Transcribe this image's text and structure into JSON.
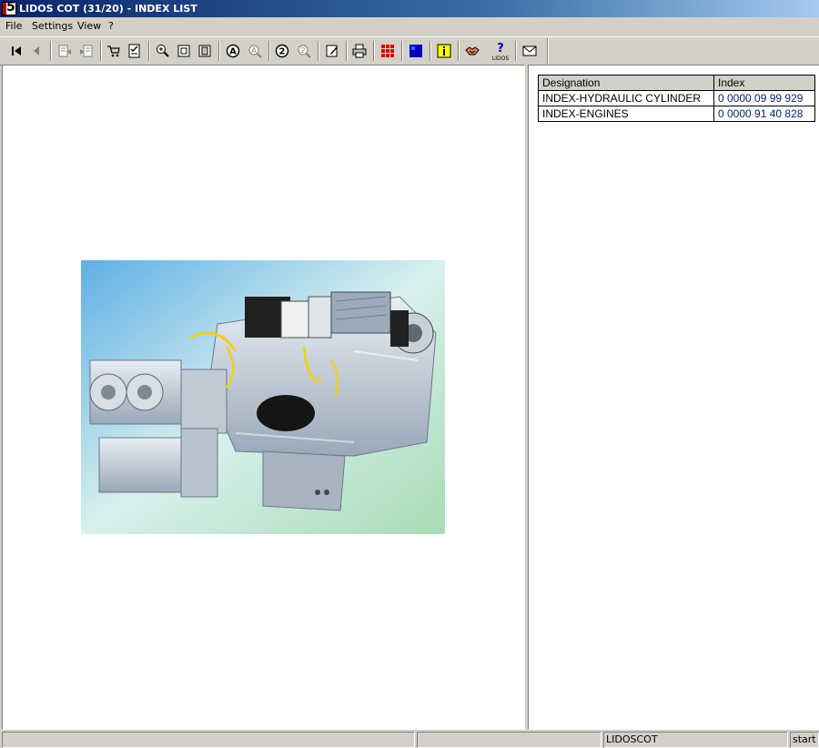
{
  "window": {
    "title": "LIDOS COT (31/20) - INDEX LIST",
    "app_icon_glyph": "5"
  },
  "menu": [
    "File",
    "Settings",
    "View",
    "?"
  ],
  "toolbar": {
    "icons": [
      "first-page-icon",
      "previous-page-icon",
      "document-back-icon",
      "document-forward-icon",
      "cart-icon",
      "checklist-icon",
      "zoom-in-icon",
      "fit-page-icon",
      "fit-width-icon",
      "search-a-icon",
      "search-next-a-icon",
      "search-2-icon",
      "search-next-2-icon",
      "notes-icon",
      "print-icon",
      "grid-icon",
      "blue-square-icon",
      "info-icon",
      "handshake-icon",
      "help-icon",
      "mail-icon"
    ],
    "lidos_label": "LIDOS"
  },
  "index_table": {
    "headers": [
      "Designation",
      "Index"
    ],
    "rows": [
      {
        "designation": "INDEX-HYDRAULIC CYLINDER",
        "index": "0 0000 09 99 929"
      },
      {
        "designation": "INDEX-ENGINES",
        "index": "0 0000 91 40 828"
      }
    ]
  },
  "statusbar": {
    "app_name": "LIDOSCOT",
    "mode": "start"
  },
  "colors": {
    "titlebar": "#0a246a",
    "index_text": "#0a246a",
    "photo_bg_left": "#5fb0e6",
    "photo_bg_right": "#a8dcb4"
  }
}
